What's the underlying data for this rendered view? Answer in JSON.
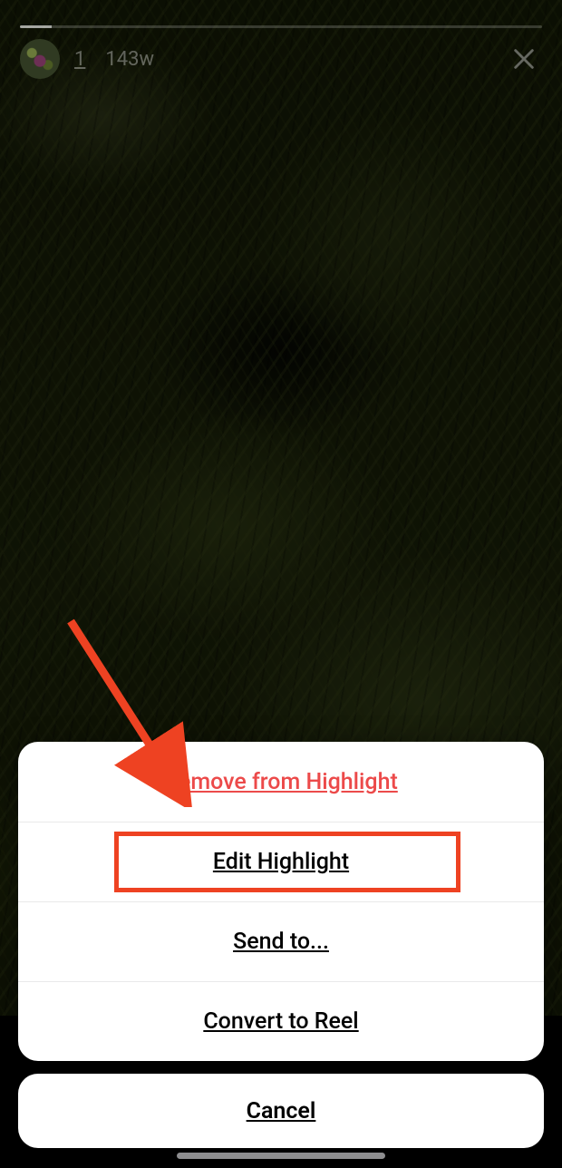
{
  "header": {
    "story_index": "1",
    "age": "143w"
  },
  "sheet": {
    "remove": "Remove from Highlight",
    "edit": "Edit Highlight",
    "send": "Send to...",
    "convert": "Convert to Reel",
    "cancel": "Cancel"
  },
  "annotation": {
    "arrow_color": "#ee4222",
    "highlight_target": "edit"
  }
}
